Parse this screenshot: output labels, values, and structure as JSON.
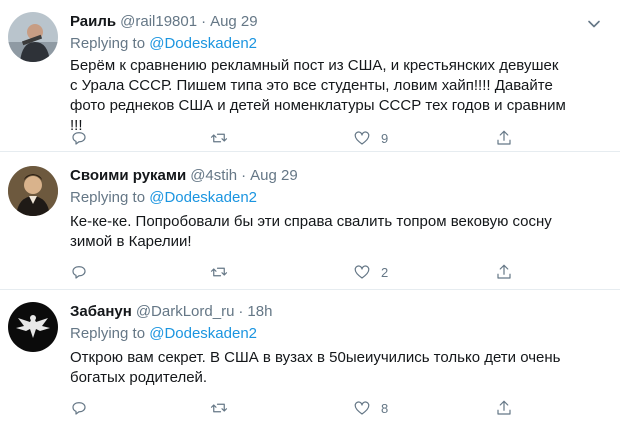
{
  "tweets": [
    {
      "name": "Раиль",
      "handle": "@rail19801",
      "separator": "·",
      "time": "Aug 29",
      "replying_prefix": "Replying to",
      "replying_to": "@Dodeskaden2",
      "text": "Берём к сравнению рекламный пост из США, и крестьянских девушек с Урала СССР. Пишем типа это все студенты, ловим хайп!!!! Давайте фото реднеков США и детей номенклатуры СССР тех годов и сравним !!!",
      "likes": "9",
      "avatar_icon": "person-photo-avatar"
    },
    {
      "name": "Своими руками",
      "handle": "@4stih",
      "separator": "·",
      "time": "Aug 29",
      "replying_prefix": "Replying to",
      "replying_to": "@Dodeskaden2",
      "text": "Ке-ке-ке. Попробовали бы эти справа свалить топром вековую сосну зимой в Карелии!",
      "likes": "2",
      "avatar_icon": "portrait-painting-avatar"
    },
    {
      "name": "Забанун",
      "handle": "@DarkLord_ru",
      "separator": "·",
      "time": "18h",
      "replying_prefix": "Replying to",
      "replying_to": "@Dodeskaden2",
      "text": "Открою вам секрет. В США в вузах в 50ыеиучились только дети очень богатых родителей.",
      "likes": "8",
      "avatar_icon": "eagle-emblem-avatar"
    }
  ],
  "colors": {
    "link": "#1b95e0",
    "muted": "#657786",
    "text": "#14171a",
    "divider": "#e6ecf0"
  },
  "icons": [
    "reply-icon",
    "retweet-icon",
    "like-icon",
    "share-icon",
    "caret-down-icon"
  ]
}
